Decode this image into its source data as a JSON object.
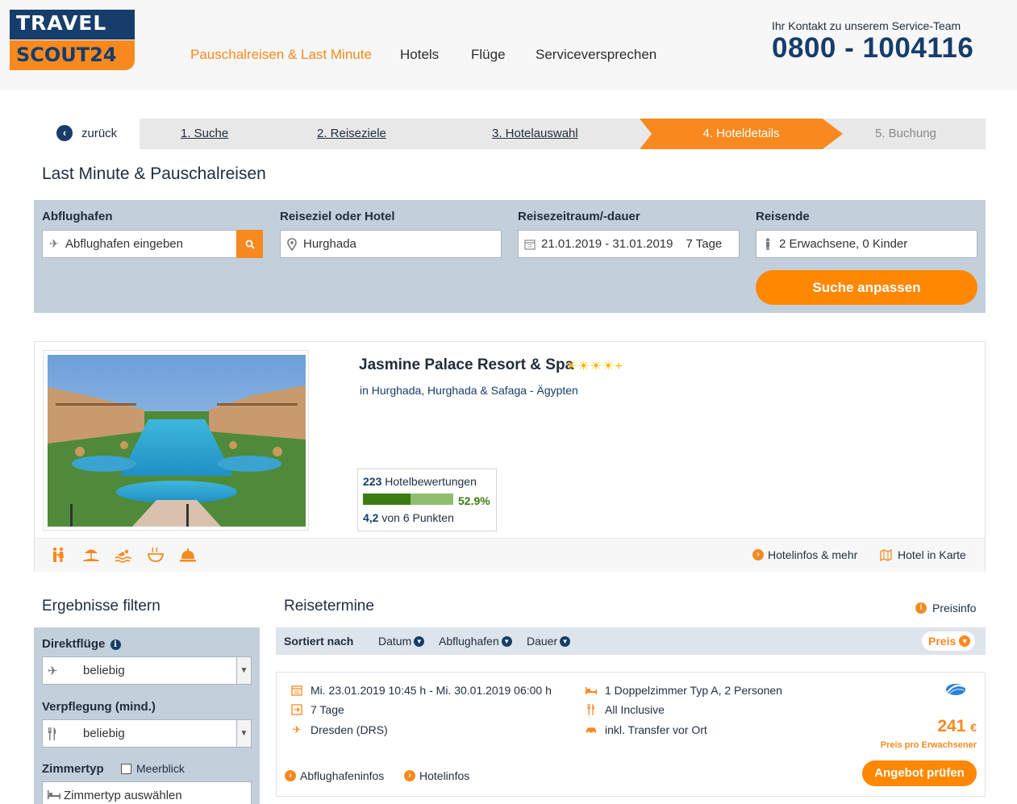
{
  "header": {
    "logo_line1": "TRAVEL",
    "logo_line2": "SCOUT24",
    "nav": [
      "Pauschalreisen & Last Minute",
      "Hotels",
      "Flüge",
      "Serviceversprechen"
    ],
    "contact_label": "Ihr Kontakt zu unserem Service-Team",
    "contact_phone": "0800 - 1004116"
  },
  "steps": {
    "back_label": "zurück",
    "items": [
      "1. Suche",
      "2. Reiseziele",
      "3. Hotelauswahl",
      "4. Hoteldetails",
      "5. Buchung"
    ],
    "active_index": 3
  },
  "page_title": "Last Minute & Pauschalreisen",
  "search": {
    "airport_label": "Abflughafen",
    "airport_placeholder": "Abflughafen eingeben",
    "destination_label": "Reiseziel oder Hotel",
    "destination_value": "Hurghada",
    "period_label": "Reisezeitraum/-dauer",
    "period_dates": "21.01.2019 - 31.01.2019",
    "period_duration": "7 Tage",
    "travelers_label": "Reisende",
    "travelers_value": "2 Erwachsene, 0 Kinder",
    "submit_label": "Suche anpassen"
  },
  "hotel": {
    "name": "Jasmine Palace Resort & Spa",
    "stars": "☀☀☀☀+",
    "location": "in Hurghada, Hurghada & Safaga - Ägypten",
    "rating_count": "223",
    "rating_count_label": "Hotelbewertungen",
    "rating_percent": "52.9%",
    "rating_fraction": 0.529,
    "rating_score": "4,2",
    "rating_score_label": "von 6 Punkten",
    "amenities": [
      "family-icon",
      "beach-icon",
      "swimming-icon",
      "spa-icon",
      "service-bell-icon"
    ],
    "link_info": "Hotelinfos & mehr",
    "link_map": "Hotel in Karte"
  },
  "filters": {
    "title": "Ergebnisse filtern",
    "direct_label": "Direktflüge",
    "direct_value": "beliebig",
    "board_label": "Verpflegung (mind.)",
    "board_value": "beliebig",
    "room_label": "Zimmertyp",
    "seaview_label": "Meerblick",
    "room_placeholder": "Zimmertyp auswählen"
  },
  "results": {
    "title": "Reisetermine",
    "price_info": "Preisinfo",
    "sort_label": "Sortiert nach",
    "sort_options": [
      "Datum",
      "Abflughafen",
      "Dauer"
    ],
    "sort_active": "Preis",
    "offer": {
      "dates": "Mi. 23.01.2019 10:45 h - Mi. 30.01.2019 06:00 h",
      "duration": "7 Tage",
      "departure": "Dresden (DRS)",
      "room": "1 Doppelzimmer Typ A, 2 Personen",
      "board": "All Inclusive",
      "transfer": "inkl. Transfer vor Ort",
      "price": "241",
      "currency": "€",
      "price_note": "Preis pro Erwachsener",
      "cta": "Angebot prüfen",
      "link_airport": "Abflughafeninfos",
      "link_hotel": "Hotelinfos"
    }
  },
  "colors": {
    "brand_navy": "#163d6b",
    "brand_orange": "#f7891f",
    "panel_blue": "#c4cfdc",
    "rating_green": "#3c7d12"
  }
}
